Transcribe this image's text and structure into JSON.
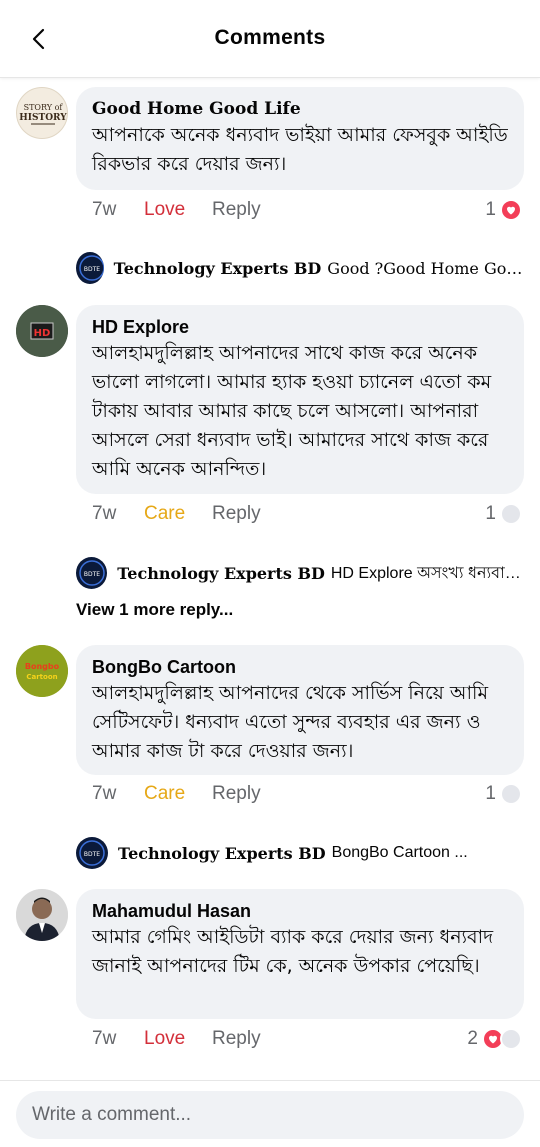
{
  "header": {
    "title": "Comments"
  },
  "comments": [
    {
      "name": "Good Home Good Life",
      "text": "আপনাকে অনেক ধন্যবাদ ভাইয়া আমার ফেসবুক আইডি রিকভার করে দেয়ার জন্য।",
      "time": "7w",
      "reaction": "Love",
      "reply": "Reply",
      "count": "1",
      "avatar_text": "STORY of HISTORY"
    },
    {
      "name": "HD Explore",
      "text": "আলহামদুলিল্লাহ আপনাদের সাথে কাজ করে অনেক ভালো লাগলো। আমার হ্যাক হওয়া চ্যানেল এতো কম টাকায় আবার আমার কাছে চলে আসলো। আপনারা আসলে সেরা ধন্যবাদ ভাই। আমাদের সাথে কাজ করে আমি অনেক আনন্দিত।",
      "time": "7w",
      "reaction": "Care",
      "reply": "Reply",
      "count": "1",
      "avatar_text": "HD"
    },
    {
      "name": "BongBo Cartoon",
      "text": "আলহামদুলিল্লাহ আপনাদের থেকে সার্ভিস নিয়ে আমি সেটিসফেট। ধন্যবাদ এতো সুন্দর ব্যবহার এর জন্য ও আমার কাজ টা করে দেওয়ার জন্য।",
      "time": "7w",
      "reaction": "Care",
      "reply": "Reply",
      "count": "1",
      "avatar_text": "Bongbo Cartoon"
    },
    {
      "name": "Mahamudul Hasan",
      "text": "আমার গেমিং আইডিটা ব্যাক করে দেয়ার জন্য ধন্যবাদ জানাই আপনাদের টিম কে, অনেক উপকার পেয়েছি।",
      "time": "7w",
      "reaction": "Love",
      "reply": "Reply",
      "count": "2"
    }
  ],
  "replies": [
    {
      "name": "Technology Experts BD",
      "text": "Good ?Good Home Good L..."
    },
    {
      "name": "Technology Experts BD",
      "text": "HD Explore অসংখ্য ধন্যবাদ ..."
    },
    {
      "name": "Technology Experts BD",
      "text": "BongBo Cartoon ..."
    }
  ],
  "view_more": "View 1 more reply...",
  "composer": {
    "placeholder": "Write a comment..."
  },
  "colors": {
    "love": "#d32f3a",
    "care": "#e6a817",
    "bubble": "#f0f2f5",
    "heart": "#f33e58"
  },
  "icons": [
    "back-arrow-icon",
    "heart-icon"
  ]
}
